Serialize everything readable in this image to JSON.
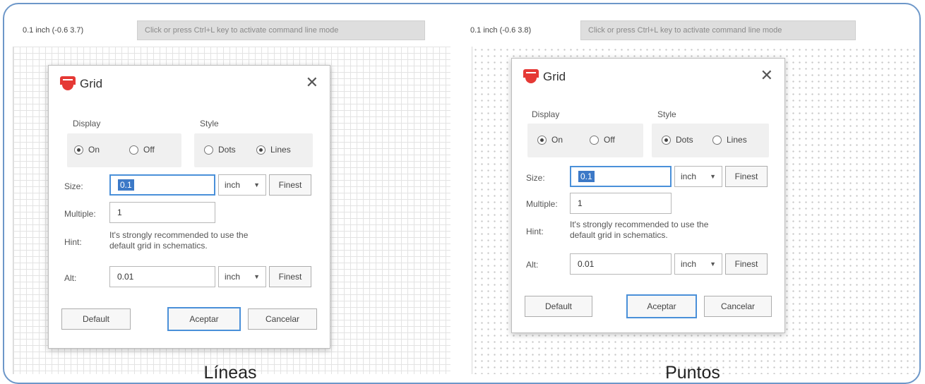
{
  "panels": [
    {
      "coords": "0.1 inch (-0.6 3.7)",
      "command_placeholder": "Click or press Ctrl+L key to activate command line mode",
      "caption": "Líneas",
      "grid_style": "lines",
      "dialog": {
        "title": "Grid",
        "display_label": "Display",
        "display_on": "On",
        "display_off": "Off",
        "display_selected": "On",
        "style_label": "Style",
        "style_dots": "Dots",
        "style_lines": "Lines",
        "style_selected": "Lines",
        "size_label": "Size:",
        "size_value": "0.1",
        "size_unit": "inch",
        "finest": "Finest",
        "multiple_label": "Multiple:",
        "multiple_value": "1",
        "hint_label": "Hint:",
        "hint_line1": "It's strongly recommended to use the",
        "hint_line2": "default grid in schematics.",
        "alt_label": "Alt:",
        "alt_value": "0.01",
        "alt_unit": "inch",
        "default_button": "Default",
        "accept_button": "Aceptar",
        "cancel_button": "Cancelar"
      }
    },
    {
      "coords": "0.1 inch (-0.6 3.8)",
      "command_placeholder": "Click or press Ctrl+L key to activate command line mode",
      "caption": "Puntos",
      "grid_style": "dots",
      "dialog": {
        "title": "Grid",
        "display_label": "Display",
        "display_on": "On",
        "display_off": "Off",
        "display_selected": "On",
        "style_label": "Style",
        "style_dots": "Dots",
        "style_lines": "Lines",
        "style_selected": "Dots",
        "size_label": "Size:",
        "size_value": "0.1",
        "size_unit": "inch",
        "finest": "Finest",
        "multiple_label": "Multiple:",
        "multiple_value": "1",
        "hint_label": "Hint:",
        "hint_line1": "It's strongly recommended to use the",
        "hint_line2": "default grid in schematics.",
        "alt_label": "Alt:",
        "alt_value": "0.01",
        "alt_unit": "inch",
        "default_button": "Default",
        "accept_button": "Aceptar",
        "cancel_button": "Cancelar"
      }
    }
  ],
  "colors": {
    "frame_border": "#6d97c9",
    "focus_blue": "#4a90d9",
    "icon_red": "#e53935"
  }
}
